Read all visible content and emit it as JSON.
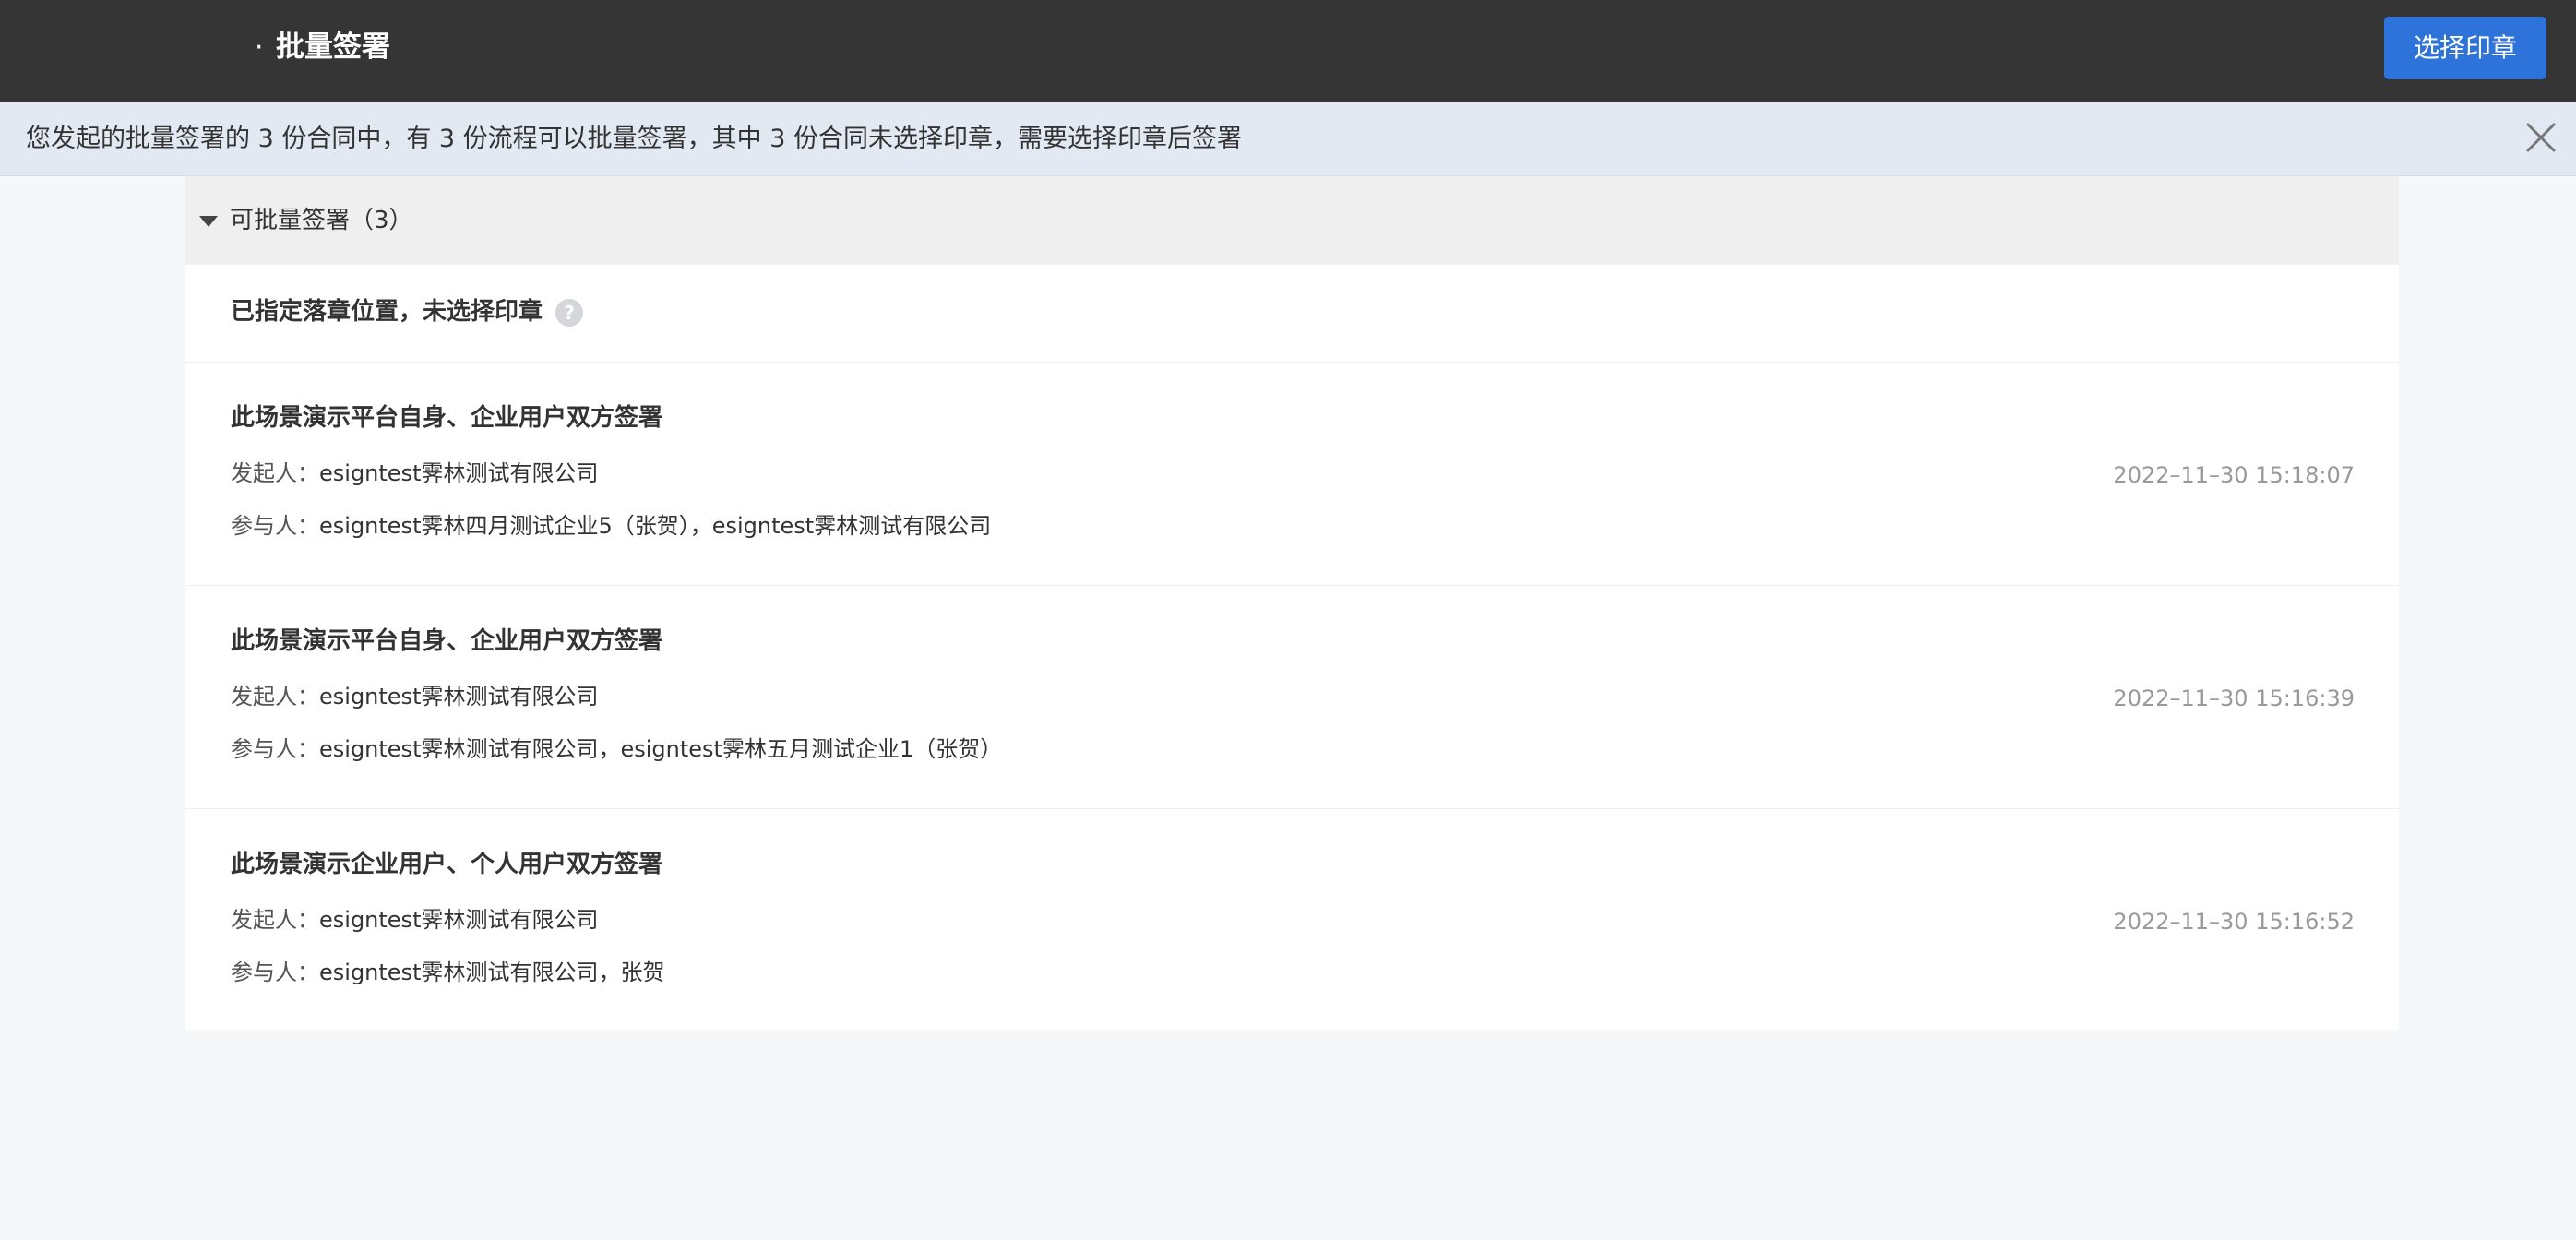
{
  "header": {
    "title_prefix": "·",
    "title": "批量签署",
    "select_seal_button": "选择印章"
  },
  "notice": {
    "text": "您发起的批量签署的 3 份合同中，有 3 份流程可以批量签署，其中 3 份合同未选择印章，需要选择印章后签署"
  },
  "group": {
    "label": "可批量签署（3）",
    "subsection_title": "已指定落章位置，未选择印章",
    "help_glyph": "?"
  },
  "contracts": [
    {
      "title": "此场景演示平台自身、企业用户双方签署",
      "initiator_label": "发起人：",
      "initiator": "esigntest霁林测试有限公司",
      "participants_label": "参与人：",
      "participants": "esigntest霁林四月测试企业5（张贺），esigntest霁林测试有限公司",
      "time": "2022–11–30 15:18:07"
    },
    {
      "title": "此场景演示平台自身、企业用户双方签署",
      "initiator_label": "发起人：",
      "initiator": "esigntest霁林测试有限公司",
      "participants_label": "参与人：",
      "participants": "esigntest霁林测试有限公司，esigntest霁林五月测试企业1（张贺）",
      "time": "2022–11–30 15:16:39"
    },
    {
      "title": "此场景演示企业用户、个人用户双方签署",
      "initiator_label": "发起人：",
      "initiator": "esigntest霁林测试有限公司",
      "participants_label": "参与人：",
      "participants": "esigntest霁林测试有限公司，张贺",
      "time": "2022–11–30 15:16:52"
    }
  ],
  "colors": {
    "topbar": "#353535",
    "primary": "#2e73d9",
    "notice_bg": "#e3e9f3",
    "group_header_bg": "#efefef",
    "page_bg": "#f6f7f9",
    "time_text": "#999999"
  },
  "icons": {
    "notice_close": "close-icon",
    "group_toggle": "caret-down-icon",
    "subsection_help": "question-circle-icon"
  }
}
